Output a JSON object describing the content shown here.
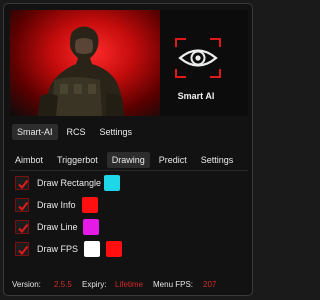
{
  "banner": {
    "brand_name": "Smart AI"
  },
  "top_tabs": {
    "items": [
      {
        "label": "Smart-AI",
        "active": true
      },
      {
        "label": "RCS",
        "active": false
      },
      {
        "label": "Settings",
        "active": false
      }
    ]
  },
  "sub_tabs": {
    "items": [
      {
        "label": "Aimbot",
        "active": false
      },
      {
        "label": "Triggerbot",
        "active": false
      },
      {
        "label": "Drawing",
        "active": true
      },
      {
        "label": "Predict",
        "active": false
      },
      {
        "label": "Settings",
        "active": false
      }
    ]
  },
  "drawing_options": [
    {
      "label": "Draw Rectangle",
      "checked": true,
      "colors": [
        "#1ed8e8"
      ]
    },
    {
      "label": "Draw Info",
      "checked": true,
      "colors": [
        "#ff0f0f"
      ]
    },
    {
      "label": "Draw Line",
      "checked": true,
      "colors": [
        "#e61ae6"
      ]
    },
    {
      "label": "Draw FPS",
      "checked": true,
      "colors": [
        "#ffffff",
        "#ff0f0f"
      ]
    }
  ],
  "footer": {
    "version_label": "Version:",
    "version_value": "2.5.5",
    "expiry_label": "Expiry:",
    "expiry_value": "Lifetime",
    "fps_label": "Menu FPS:",
    "fps_value": "207"
  },
  "colors": {
    "accent": "#d12a2a",
    "checkbox_border": "#7a1010",
    "active_tab": "#2c2c2c"
  },
  "icons": {
    "brand": "eye-scan-icon",
    "checkbox": "check-icon"
  }
}
